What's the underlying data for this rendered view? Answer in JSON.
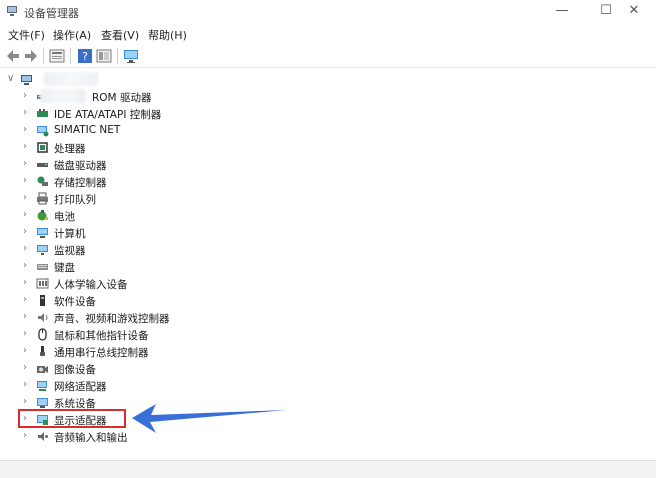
{
  "window": {
    "title": "设备管理器",
    "minimize_glyph": "—",
    "maximize_glyph": "☐",
    "close_glyph": "✕"
  },
  "menu": {
    "file": "文件(F)",
    "action": "操作(A)",
    "view": "查看(V)",
    "help": "帮助(H)"
  },
  "toolbar": {
    "icons": [
      "back-arrow-icon",
      "forward-arrow-icon",
      "properties-icon",
      "help-icon",
      "view-icon",
      "monitor-icon"
    ]
  },
  "tree": {
    "root_label": "",
    "items": [
      {
        "label": "ROM 驱动器",
        "icon": "cdrom-icon"
      },
      {
        "label": "IDE ATA/ATAPI 控制器",
        "icon": "ide-controller-icon"
      },
      {
        "label": "SIMATIC NET",
        "icon": "network-icon"
      },
      {
        "label": "处理器",
        "icon": "processor-icon"
      },
      {
        "label": "磁盘驱动器",
        "icon": "disk-drive-icon"
      },
      {
        "label": "存储控制器",
        "icon": "storage-controller-icon"
      },
      {
        "label": "打印队列",
        "icon": "printer-icon"
      },
      {
        "label": "电池",
        "icon": "battery-icon"
      },
      {
        "label": "计算机",
        "icon": "computer-icon"
      },
      {
        "label": "监视器",
        "icon": "monitor-icon"
      },
      {
        "label": "键盘",
        "icon": "keyboard-icon"
      },
      {
        "label": "人体学输入设备",
        "icon": "hid-icon"
      },
      {
        "label": "软件设备",
        "icon": "software-device-icon"
      },
      {
        "label": "声音、视频和游戏控制器",
        "icon": "sound-icon"
      },
      {
        "label": "鼠标和其他指针设备",
        "icon": "mouse-icon"
      },
      {
        "label": "通用串行总线控制器",
        "icon": "usb-icon"
      },
      {
        "label": "图像设备",
        "icon": "camera-icon"
      },
      {
        "label": "网络适配器",
        "icon": "network-adapter-icon"
      },
      {
        "label": "系统设备",
        "icon": "system-device-icon"
      },
      {
        "label": "显示适配器",
        "icon": "display-adapter-icon"
      },
      {
        "label": "音频输入和输出",
        "icon": "audio-io-icon"
      }
    ],
    "highlighted_item": "显示适配器"
  },
  "colors": {
    "highlight_border": "#d92c2c",
    "arrow": "#3b6fd8",
    "folder": "#e6b325",
    "monitor": "#3a8fd6"
  }
}
